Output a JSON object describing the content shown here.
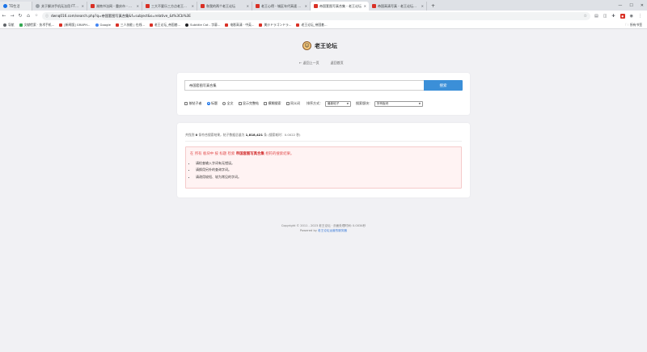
{
  "browser": {
    "tabs": [
      {
        "title": "TD生活",
        "favicon": "blue"
      },
      {
        "title": "关于解决手机无法用 FTP 登",
        "favicon": "grey"
      },
      {
        "title": "湖南书法网 - 重庆市 - 论坛",
        "favicon": "red"
      },
      {
        "title": "三大不要乐三方点老王论坛",
        "favicon": "red"
      },
      {
        "title": "和我的两个老王论坛",
        "favicon": "red"
      },
      {
        "title": "老王心得 - 城区年代高速 PHP",
        "favicon": "red"
      },
      {
        "title": "帝国套图写真合集 - 老王论坛",
        "favicon": "red"
      },
      {
        "title": "帝国高清写真 - 老王论坛搜索",
        "favicon": "red"
      }
    ],
    "active_tab_index": 6,
    "url": "dwnq016.com/search.php?q=帝国套图写真合集&f=subject&s=relative_&t%3Cb%3E",
    "bookmarks": [
      {
        "label": "导航",
        "color": "#1a73e8"
      },
      {
        "label": "文献检索 · 技术手机...",
        "color": "#34a853"
      },
      {
        "label": "[新闻版] GRAPH...",
        "color": "#d93025"
      },
      {
        "label": "Google",
        "color": "#4285f4"
      },
      {
        "label": "三人技能 | 在线...",
        "color": "#d93025"
      },
      {
        "label": "老王论坛_帝国套...",
        "color": "#d93025"
      },
      {
        "label": "Subtitle Cat - 字幕...",
        "color": "#202124"
      },
      {
        "label": "电影高清 · 中英...",
        "color": "#d93025"
      },
      {
        "label": "美沙ドラゴンドラ...",
        "color": "#d93025"
      },
      {
        "label": "老王论坛_帝国套...",
        "color": "#d93025"
      }
    ],
    "all_bookmarks_label": "所有书签"
  },
  "site": {
    "name": "老王论坛"
  },
  "nav": {
    "back_label": "← 返回上一页",
    "home_label": "返回首页"
  },
  "search": {
    "query": "帝国套图写真合集",
    "button_label": "搜索",
    "options": {
      "author": "按帖子者",
      "title": "标题",
      "fulltext": "全文",
      "show_content": "显示完整帖",
      "fuzzy": "模糊搜索",
      "synonyms": "同义词",
      "sort_label": "排序方式：",
      "sort_value": "最新帖子",
      "forum_label": "搜索版块：",
      "forum_value": "所有板块"
    },
    "selected_scope": "title"
  },
  "results": {
    "stats_prefix": "共找到",
    "count": "0",
    "stats_middle": "条符合搜索结果，帖子数据总量为",
    "total": "1,818,421",
    "stats_suffix": "条 (搜索耗时：0.0022 秒)",
    "no_result_prefix": "在 所有 板块中 按 标题 检索",
    "no_result_keyword": "帝国套图写真合集",
    "no_result_suffix": "相符的搜索结果。",
    "tips": [
      "请检查输入字词有无错误。",
      "请换用另外的查询字词。",
      "请改用较短、较为常见的字词。"
    ]
  },
  "footer": {
    "copyright": "Copyright © 2011 - 2023 老王论坛 · 页面处理时间: 0.0034秒",
    "powered_prefix": "Powered by",
    "powered_link": "老王论坛运营的服务器"
  }
}
